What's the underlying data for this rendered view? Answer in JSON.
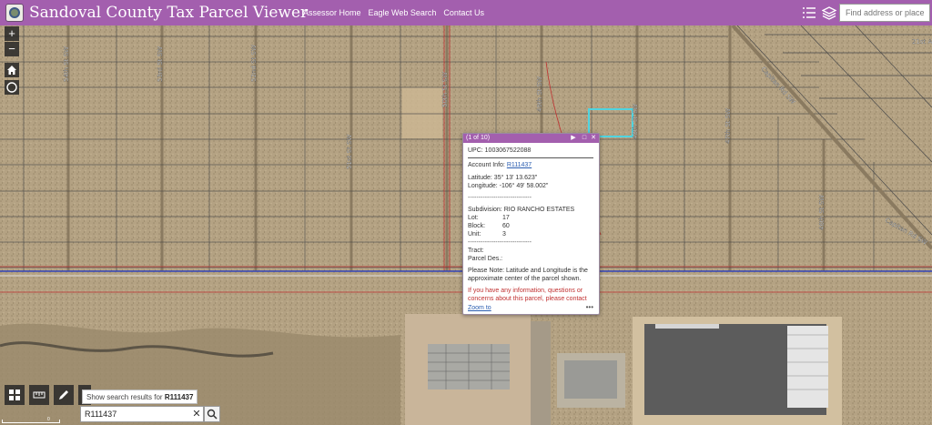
{
  "header": {
    "title": "Sandoval County Tax Parcel Viewer",
    "nav": [
      "Assessor Home",
      "Eagle Web Search",
      "Contact Us"
    ],
    "search_placeholder": "Find address or place"
  },
  "map": {
    "streets": [
      {
        "label": "54th St SW"
      },
      {
        "label": "53rd St SW"
      },
      {
        "label": "52nd St SW"
      },
      {
        "label": "51st St SW"
      },
      {
        "label": "50th St SW"
      },
      {
        "label": "49th St SW"
      },
      {
        "label": "48th St SW"
      },
      {
        "label": "47th St SW"
      },
      {
        "label": "46th St SW"
      },
      {
        "label": "Capitan Rd SW"
      },
      {
        "label": "Capitan Rd SW"
      },
      {
        "label": "21st A"
      }
    ],
    "scale_label": "0"
  },
  "popup": {
    "counter": "(1 of 10)",
    "upc": "UPC: 1003067522088",
    "account_label": "Account Info:",
    "account_value": "R111437",
    "latitude": "Latitude: 35° 13' 13.623\"",
    "longitude": "Longitude: -106° 49' 58.002\"",
    "dashes": "------------------------------",
    "subdivision": "Subdivision: RIO RANCHO ESTATES",
    "rows": [
      {
        "k": "Lot:",
        "v": "17"
      },
      {
        "k": "Block:",
        "v": "60"
      },
      {
        "k": "Unit:",
        "v": "3"
      }
    ],
    "tract": "Tract:",
    "parcel_des": "Parcel Des.:",
    "note": "Please Note: Latitude and Longitude is the approximate center of the parcel shown.",
    "contact": "If you have any information, questions or concerns about this parcel, please contact",
    "zoom_to": "Zoom to",
    "more": "•••"
  },
  "search": {
    "tooltip_prefix": "Show search results for",
    "tooltip_value": "R111437",
    "value": "R111437"
  },
  "colors": {
    "header": "#a35fae",
    "parcel_lines": "#4a4a4a",
    "highlight": "#4fd4e0"
  }
}
